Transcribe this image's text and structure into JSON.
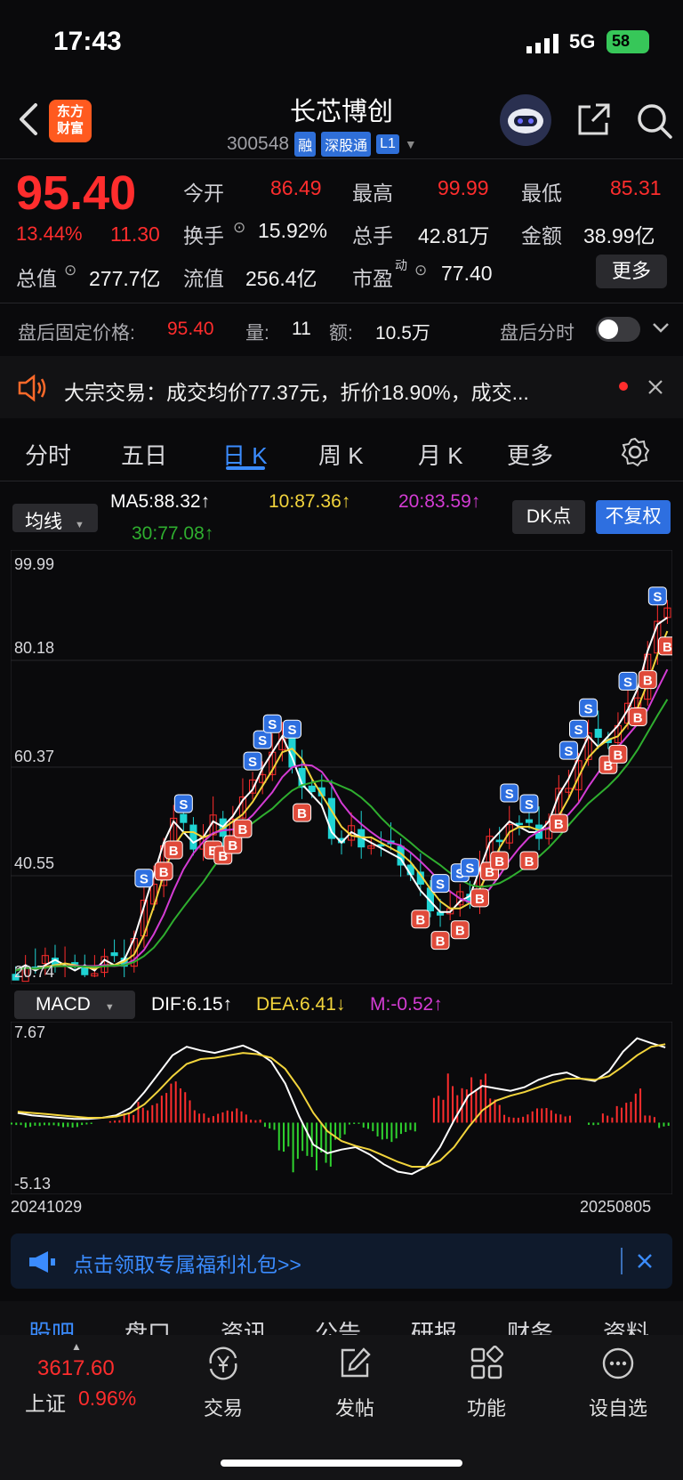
{
  "status_bar": {
    "time": "17:43",
    "network": "5G",
    "battery": "58"
  },
  "header": {
    "logo_text": "东方财富",
    "stock_name": "长芯博创",
    "stock_code": "300548",
    "tags": [
      "融",
      "深股通",
      "L1"
    ]
  },
  "quote": {
    "price": "95.40",
    "change_pct": "13.44%",
    "change": "11.30",
    "open_label": "今开",
    "open": "86.49",
    "high_label": "最高",
    "high": "99.99",
    "low_label": "最低",
    "low": "85.31",
    "turnover_label": "换手",
    "turnover": "15.92%",
    "volume_label": "总手",
    "volume": "42.81万",
    "amount_label": "金额",
    "amount": "38.99亿",
    "mktcap_label": "总值",
    "mktcap": "277.7亿",
    "float_label": "流值",
    "float": "256.4亿",
    "pe_label": "市盈",
    "pe_sup": "动",
    "pe": "77.40",
    "more_label": "更多"
  },
  "after_hours": {
    "label": "盘后固定价格:",
    "price": "95.40",
    "vol_label": "量:",
    "vol": "11",
    "amt_label": "额:",
    "amt": "10.5万",
    "toggle_label": "盘后分时"
  },
  "news": {
    "text": "大宗交易：成交均价77.37元，折价18.90%，成交..."
  },
  "tabs": [
    "分时",
    "五日",
    "日 K",
    "周 K",
    "月 K",
    "更多"
  ],
  "active_tab": "日 K",
  "ma_row": {
    "select": "均线",
    "ma5": "MA5:88.32↑",
    "ma10": "10:87.36↑",
    "ma20": "20:83.59↑",
    "ma30": "30:77.08↑",
    "dk": "DK点",
    "fq": "不复权"
  },
  "colors": {
    "ma5": "#ffffff",
    "ma10": "#f2d43c",
    "ma20": "#d43cd4",
    "ma30": "#2fae2f",
    "up": "#ff2d2d",
    "down": "#1fd3d3",
    "accent": "#3b8cff"
  },
  "chart_data": {
    "type": "candlestick",
    "y_ticks": [
      "99.99",
      "80.18",
      "60.37",
      "40.55",
      "20.74"
    ],
    "ylim": [
      20.74,
      99.99
    ],
    "x_start": "20241029",
    "x_end": "20250805",
    "ma5_close": [
      22,
      23,
      22,
      23,
      24,
      23,
      22,
      23,
      22,
      24,
      23,
      24,
      28,
      34,
      40,
      46,
      50,
      48,
      46,
      47,
      50,
      49,
      51,
      54,
      56,
      60,
      63,
      66,
      62,
      57,
      55,
      53,
      48,
      46,
      48,
      47,
      46,
      45,
      44,
      43,
      40,
      37,
      35,
      33,
      33,
      35,
      36,
      41,
      46,
      48,
      50,
      49,
      48,
      48,
      50,
      55,
      58,
      62,
      66,
      64,
      66,
      68,
      71,
      75,
      82,
      87,
      88.3
    ],
    "macd": {
      "label": "MACD",
      "dif_text": "DIF:6.15↑",
      "dea_text": "DEA:6.41↓",
      "m_text": "M:-0.52↑",
      "ylim": [
        -5.13,
        7.67
      ],
      "y_ticks": [
        "7.67",
        "-5.13"
      ],
      "dif": [
        0.8,
        0.6,
        0.5,
        0.4,
        0.3,
        0.3,
        0.4,
        0.6,
        1.2,
        2.5,
        4.0,
        5.5,
        6.2,
        5.9,
        5.7,
        6.0,
        6.3,
        5.8,
        5.0,
        3.2,
        0.5,
        -1.8,
        -2.5,
        -2.2,
        -2.0,
        -2.6,
        -3.4,
        -4.0,
        -4.2,
        -3.6,
        -2.0,
        0.2,
        2.2,
        3.0,
        2.8,
        2.6,
        2.9,
        3.5,
        3.9,
        4.1,
        3.6,
        3.4,
        4.2,
        5.8,
        6.9,
        6.5,
        6.15
      ],
      "dea": [
        0.9,
        0.8,
        0.7,
        0.6,
        0.5,
        0.4,
        0.4,
        0.5,
        0.8,
        1.5,
        2.6,
        3.8,
        4.8,
        5.2,
        5.3,
        5.5,
        5.7,
        5.6,
        5.3,
        4.4,
        2.8,
        0.8,
        -0.7,
        -1.5,
        -1.9,
        -2.2,
        -2.7,
        -3.2,
        -3.6,
        -3.6,
        -3.1,
        -2.0,
        -0.4,
        1.0,
        1.8,
        2.2,
        2.5,
        2.9,
        3.3,
        3.6,
        3.6,
        3.5,
        3.8,
        4.6,
        5.5,
        6.2,
        6.41
      ]
    }
  },
  "promo": {
    "text": "点击领取专属福利礼包>>"
  },
  "sub_tabs": [
    "股吧",
    "盘口",
    "资讯",
    "公告",
    "研报",
    "财务",
    "资料"
  ],
  "bottom_nav": {
    "index_value": "3617.60",
    "index_name": "上证",
    "index_change": "0.96%",
    "items": [
      "交易",
      "发帖",
      "功能",
      "设自选"
    ]
  }
}
